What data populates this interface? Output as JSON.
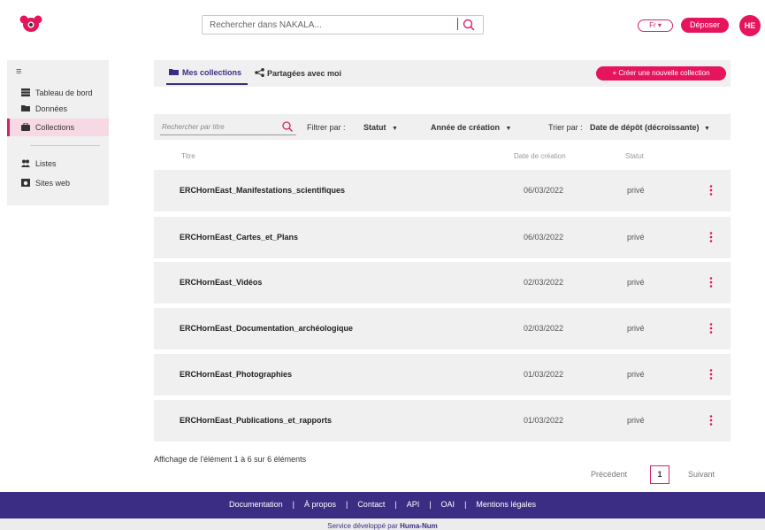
{
  "header": {
    "search_placeholder": "Rechercher dans NAKALA...",
    "lang": "Fr",
    "deposit_label": "Déposer",
    "avatar_initials": "HE"
  },
  "sidebar": {
    "items": [
      {
        "label": "Tableau de bord",
        "icon": "table-icon"
      },
      {
        "label": "Données",
        "icon": "folder-icon"
      },
      {
        "label": "Collections",
        "icon": "briefcase-icon",
        "active": true
      },
      {
        "label": "Listes",
        "icon": "users-icon"
      },
      {
        "label": "Sites web",
        "icon": "web-icon"
      }
    ]
  },
  "tabs": {
    "mine": "Mes collections",
    "shared": "Partagées avec moi",
    "create": "+ Créer une nouvelle collection"
  },
  "filters": {
    "title_placeholder": "Rechercher par titre",
    "filter_by": "Filtrer par :",
    "status": "Statut",
    "year": "Année de création",
    "sort_by": "Trier par :",
    "sort_value": "Date de dépôt (décroissante)"
  },
  "table": {
    "headers": {
      "title": "Titre",
      "date": "Date de création",
      "status": "Statut"
    },
    "rows": [
      {
        "title": "ERCHornEast_Manifestations_scientifiques",
        "date": "06/03/2022",
        "status": "privé"
      },
      {
        "title": "ERCHornEast_Cartes_et_Plans",
        "date": "06/03/2022",
        "status": "privé"
      },
      {
        "title": "ERCHornEast_Vidéos",
        "date": "02/03/2022",
        "status": "privé"
      },
      {
        "title": "ERCHornEast_Documentation_archéologique",
        "date": "02/03/2022",
        "status": "privé"
      },
      {
        "title": "ERCHornEast_Photographies",
        "date": "01/03/2022",
        "status": "privé"
      },
      {
        "title": "ERCHornEast_Publications_et_rapports",
        "date": "01/03/2022",
        "status": "privé"
      }
    ]
  },
  "pagination": {
    "info": "Affichage de l'élément 1 à 6 sur 6 éléments",
    "prev": "Précédent",
    "page": "1",
    "next": "Suivant"
  },
  "footer": {
    "links": [
      "Documentation",
      "À propos",
      "Contact",
      "API",
      "OAI",
      "Mentions légales"
    ],
    "service_prefix": "Service développé par ",
    "service_name": "Huma-Num"
  },
  "colors": {
    "accent": "#e6145c",
    "primary": "#3b2d83"
  }
}
